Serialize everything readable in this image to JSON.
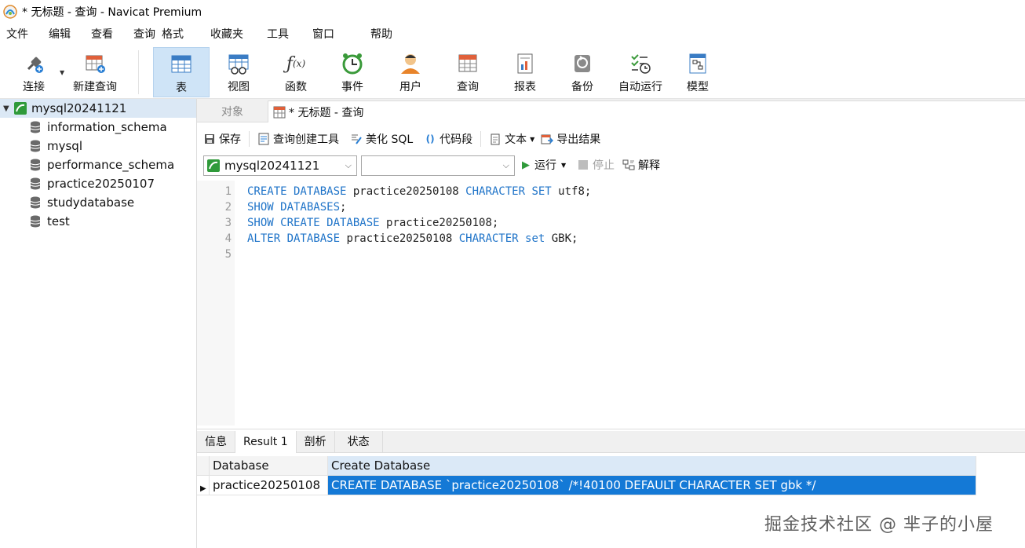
{
  "window": {
    "title": "* 无标题 - 查询 - Navicat Premium"
  },
  "menubar": [
    "文件",
    "编辑",
    "查看",
    "查询",
    "格式",
    "收藏夹",
    "工具",
    "窗口",
    "帮助"
  ],
  "toolbar": {
    "connect": "连接",
    "new_query": "新建查询",
    "table": "表",
    "view": "视图",
    "function": "函数",
    "event": "事件",
    "user": "用户",
    "query": "查询",
    "report": "报表",
    "backup": "备份",
    "autorun": "自动运行",
    "model": "模型"
  },
  "sidebar": {
    "connection": "mysql20241121",
    "databases": [
      "information_schema",
      "mysql",
      "performance_schema",
      "practice20250107",
      "studydatabase",
      "test"
    ]
  },
  "tabs": {
    "objects": "对象",
    "query_tab": "* 无标题 - 查询"
  },
  "query_toolbar": {
    "save": "保存",
    "builder": "查询创建工具",
    "beautify": "美化 SQL",
    "snippet": "代码段",
    "text": "文本",
    "export": "导出结果"
  },
  "selectors": {
    "connection": "mysql20241121",
    "database": ""
  },
  "run": {
    "run": "运行",
    "stop": "停止",
    "explain": "解释"
  },
  "editor": {
    "lines": [
      {
        "num": "1",
        "tokens": [
          [
            "kw",
            "CREATE DATABASE"
          ],
          [
            "t",
            " practice20250108 "
          ],
          [
            "kw",
            "CHARACTER SET"
          ],
          [
            "t",
            " utf8;"
          ]
        ]
      },
      {
        "num": "2",
        "tokens": [
          [
            "kw",
            "SHOW DATABASES"
          ],
          [
            "t",
            ";"
          ]
        ]
      },
      {
        "num": "3",
        "tokens": [
          [
            "kw",
            "SHOW CREATE DATABASE"
          ],
          [
            "t",
            " practice20250108;"
          ]
        ]
      },
      {
        "num": "4",
        "tokens": [
          [
            "kw",
            "ALTER DATABASE"
          ],
          [
            "t",
            " practice20250108 "
          ],
          [
            "kw",
            "CHARACTER set"
          ],
          [
            "t",
            " GBK;"
          ]
        ]
      },
      {
        "num": "5",
        "tokens": []
      }
    ]
  },
  "result_tabs": [
    "信息",
    "Result 1",
    "剖析",
    "状态"
  ],
  "result": {
    "columns": [
      "Database",
      "Create Database"
    ],
    "rows": [
      [
        "practice20250108",
        "CREATE DATABASE `practice20250108` /*!40100 DEFAULT CHARACTER SET gbk */"
      ]
    ]
  },
  "watermark": "掘金技术社区 @ 芈子的小屋",
  "colors": {
    "keyword": "#1e73c8",
    "selection": "#1479d6",
    "active_tool": "#cfe4f7"
  }
}
